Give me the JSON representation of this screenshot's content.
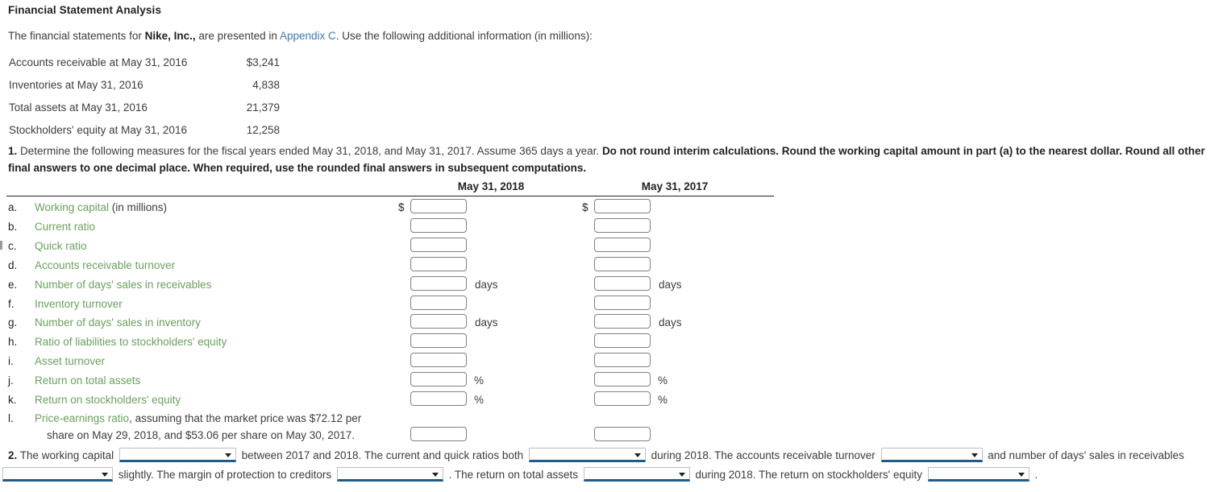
{
  "page": {
    "title": "Financial Statement Analysis"
  },
  "intro": {
    "part1": "The financial statements for ",
    "company": "Nike, Inc.,",
    "part2": " are presented in ",
    "link": "Appendix C",
    "part3": ". Use the following additional information (in millions):",
    "link_color": "#3b7bbf"
  },
  "given_data": {
    "rows": [
      {
        "label": "Accounts receivable at May 31, 2016",
        "amount": "$3,241"
      },
      {
        "label": "Inventories at May 31, 2016",
        "amount": "4,838"
      },
      {
        "label": "Total assets at May 31, 2016",
        "amount": "21,379"
      },
      {
        "label": "Stockholders' equity at May 31, 2016",
        "amount": "12,258"
      }
    ]
  },
  "requirement1": {
    "number": "1.",
    "normal_text": " Determine the following measures for the fiscal years ended May 31, 2018, and May 31, 2017. Assume 365 days a year. ",
    "bold_text": "Do not round interim calculations. Round the working capital amount in part (a) to the nearest dollar. Round all other final answers to one decimal place. When required, use the rounded final answers in subsequent computations."
  },
  "measures_table": {
    "columns": [
      {
        "header": "May 31, 2018"
      },
      {
        "header": "May 31, 2017"
      }
    ],
    "label_color": "#6aa05e",
    "rows": [
      {
        "letter": "a.",
        "label": "Working capital",
        "label_suffix": " (in millions)",
        "prefix": "$",
        "unit": "",
        "value_2018": "",
        "value_2017": ""
      },
      {
        "letter": "b.",
        "label": "Current ratio",
        "label_suffix": "",
        "prefix": "",
        "unit": "",
        "value_2018": "",
        "value_2017": ""
      },
      {
        "letter": "c.",
        "label": "Quick ratio",
        "label_suffix": "",
        "prefix": "",
        "unit": "",
        "value_2018": "",
        "value_2017": ""
      },
      {
        "letter": "d.",
        "label": "Accounts receivable turnover",
        "label_suffix": "",
        "prefix": "",
        "unit": "",
        "value_2018": "",
        "value_2017": ""
      },
      {
        "letter": "e.",
        "label": "Number of days' sales in receivables",
        "label_suffix": "",
        "prefix": "",
        "unit": "days",
        "value_2018": "",
        "value_2017": ""
      },
      {
        "letter": "f.",
        "label": "Inventory turnover",
        "label_suffix": "",
        "prefix": "",
        "unit": "",
        "value_2018": "",
        "value_2017": ""
      },
      {
        "letter": "g.",
        "label": "Number of days' sales in inventory",
        "label_suffix": "",
        "prefix": "",
        "unit": "days",
        "value_2018": "",
        "value_2017": ""
      },
      {
        "letter": "h.",
        "label": "Ratio of liabilities to stockholders' equity",
        "label_suffix": "",
        "prefix": "",
        "unit": "",
        "value_2018": "",
        "value_2017": ""
      },
      {
        "letter": "i.",
        "label": "Asset turnover",
        "label_suffix": "",
        "prefix": "",
        "unit": "",
        "value_2018": "",
        "value_2017": ""
      },
      {
        "letter": "j.",
        "label": "Return on total assets",
        "label_suffix": "",
        "prefix": "",
        "unit": "%",
        "value_2018": "",
        "value_2017": ""
      },
      {
        "letter": "k.",
        "label": "Return on stockholders' equity",
        "label_suffix": "",
        "prefix": "",
        "unit": "%",
        "value_2018": "",
        "value_2017": ""
      },
      {
        "letter": "l.",
        "label": "Price-earnings ratio",
        "label_suffix": ", assuming that the market price was $72.12 per",
        "prefix": "",
        "unit": "",
        "value_2018": "",
        "value_2017": ""
      }
    ],
    "row_l_continuation": "share on May 29, 2018, and $53.06 per share on May 30, 2017."
  },
  "requirement2": {
    "number": "2.",
    "t1": " The working capital ",
    "t2": " between 2017 and 2018. The current and quick ratios both ",
    "t3": " during 2018. The accounts receivable turnover ",
    "t4": " and number of days' sales in receivables ",
    "t5": " slightly. The margin of protection to creditors ",
    "t6": " . The return on total assets ",
    "t7": " during 2018. The return on stockholders' equity ",
    "t8": " .",
    "dropdowns": [
      {
        "name": "working-capital-trend",
        "value": ""
      },
      {
        "name": "current-quick-ratios-trend",
        "value": ""
      },
      {
        "name": "accounts-receivable-turnover-trend",
        "value": ""
      },
      {
        "name": "days-sales-receivables-trend",
        "value": ""
      },
      {
        "name": "margin-of-protection-trend",
        "value": ""
      },
      {
        "name": "return-on-total-assets-trend",
        "value": ""
      },
      {
        "name": "return-on-stockholders-equity-trend",
        "value": ""
      }
    ]
  }
}
